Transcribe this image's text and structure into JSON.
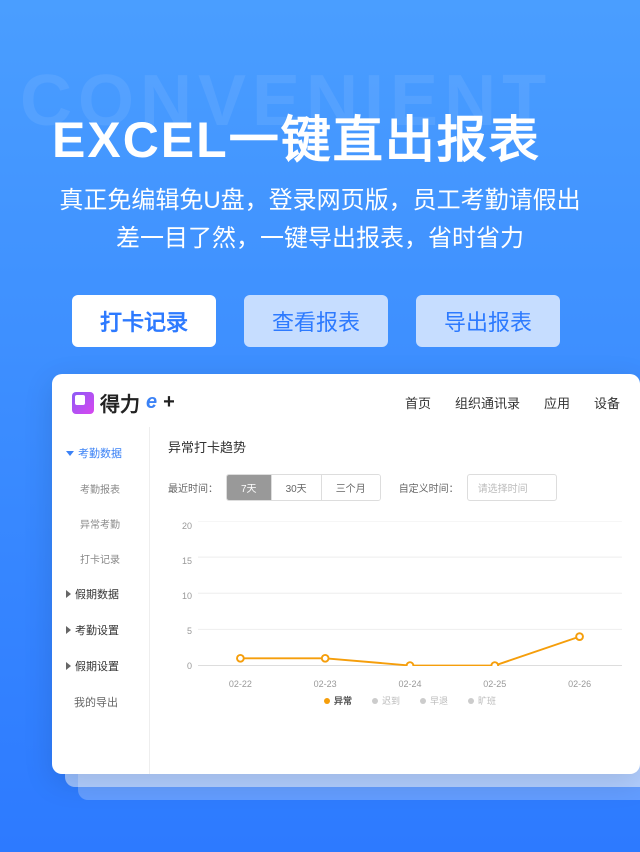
{
  "watermark": "CONVENIENT",
  "hero": {
    "title": "EXCEL一键直出报表",
    "subtitle": "真正免编辑免U盘，登录网页版，员工考勤请假出差一目了然，一键导出报表，省时省力"
  },
  "tabs": [
    {
      "label": "打卡记录",
      "active": true
    },
    {
      "label": "查看报表",
      "active": false
    },
    {
      "label": "导出报表",
      "active": false
    }
  ],
  "app": {
    "logo_text": "得力",
    "logo_e": "e",
    "logo_plus": "+",
    "nav": [
      "首页",
      "组织通讯录",
      "应用",
      "设备"
    ]
  },
  "sidebar": {
    "items": [
      {
        "label": "考勤数据",
        "type": "parent",
        "active": true,
        "expanded": true
      },
      {
        "label": "考勤报表",
        "type": "sub"
      },
      {
        "label": "异常考勤",
        "type": "sub"
      },
      {
        "label": "打卡记录",
        "type": "sub"
      },
      {
        "label": "假期数据",
        "type": "parent"
      },
      {
        "label": "考勤设置",
        "type": "parent"
      },
      {
        "label": "假期设置",
        "type": "parent"
      },
      {
        "label": "我的导出",
        "type": "plain"
      }
    ]
  },
  "main": {
    "title": "异常打卡趋势",
    "recent_label": "最近时间：",
    "segments": [
      {
        "label": "7天",
        "active": true
      },
      {
        "label": "30天",
        "active": false
      },
      {
        "label": "三个月",
        "active": false
      }
    ],
    "custom_label": "自定义时间：",
    "date_placeholder": "请选择时间"
  },
  "chart_data": {
    "type": "line",
    "title": "异常打卡趋势",
    "xlabel": "",
    "ylabel": "",
    "ylim": [
      0,
      20
    ],
    "y_ticks": [
      20,
      15,
      10,
      5,
      0
    ],
    "categories": [
      "02-22",
      "02-23",
      "02-24",
      "02-25",
      "02-26"
    ],
    "series": [
      {
        "name": "异常",
        "values": [
          1,
          1,
          0,
          0,
          4
        ],
        "color": "#f59e0b",
        "active": true
      },
      {
        "name": "迟到",
        "values": null,
        "color": "#ccc",
        "active": false
      },
      {
        "name": "早退",
        "values": null,
        "color": "#ccc",
        "active": false
      },
      {
        "name": "旷班",
        "values": null,
        "color": "#ccc",
        "active": false
      }
    ]
  }
}
